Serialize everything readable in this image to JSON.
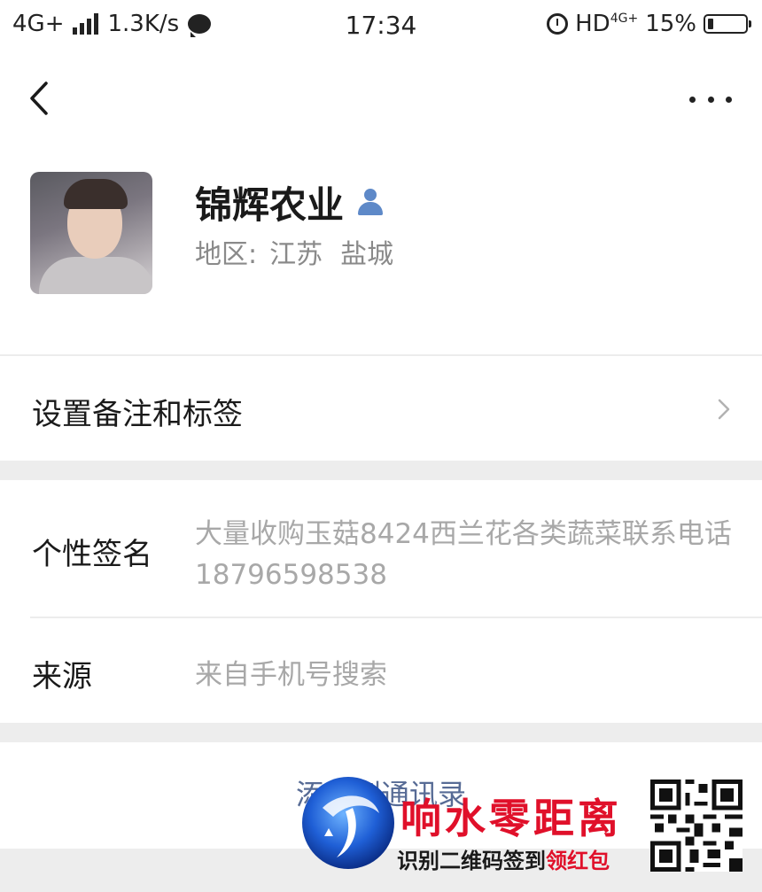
{
  "status_bar": {
    "network": "4G+",
    "speed": "1.3K/s",
    "time": "17:34",
    "hd": "HD",
    "hd_superscript": "4G+",
    "battery": "15%",
    "battery_level": 0.15
  },
  "nav": {
    "back_icon": "chevron-left-icon",
    "more_icon": "more-dots-icon"
  },
  "profile": {
    "name": "锦辉农业",
    "region_label": "地区:",
    "region_province": "江苏",
    "region_city": "盐城",
    "verified_icon": "person-icon"
  },
  "remark": {
    "label": "设置备注和标签"
  },
  "signature": {
    "label": "个性签名",
    "value": "大量收购玉菇8424西兰花各类蔬菜联系电话18796598538"
  },
  "source": {
    "label": "来源",
    "value": "来自手机号搜索"
  },
  "add_button": {
    "label": "添加到通讯录"
  },
  "watermark": {
    "title": "响水零距离",
    "subtitle_black": "识别二维码签到",
    "subtitle_red": "领红包",
    "brand_color": "#e0102a"
  }
}
